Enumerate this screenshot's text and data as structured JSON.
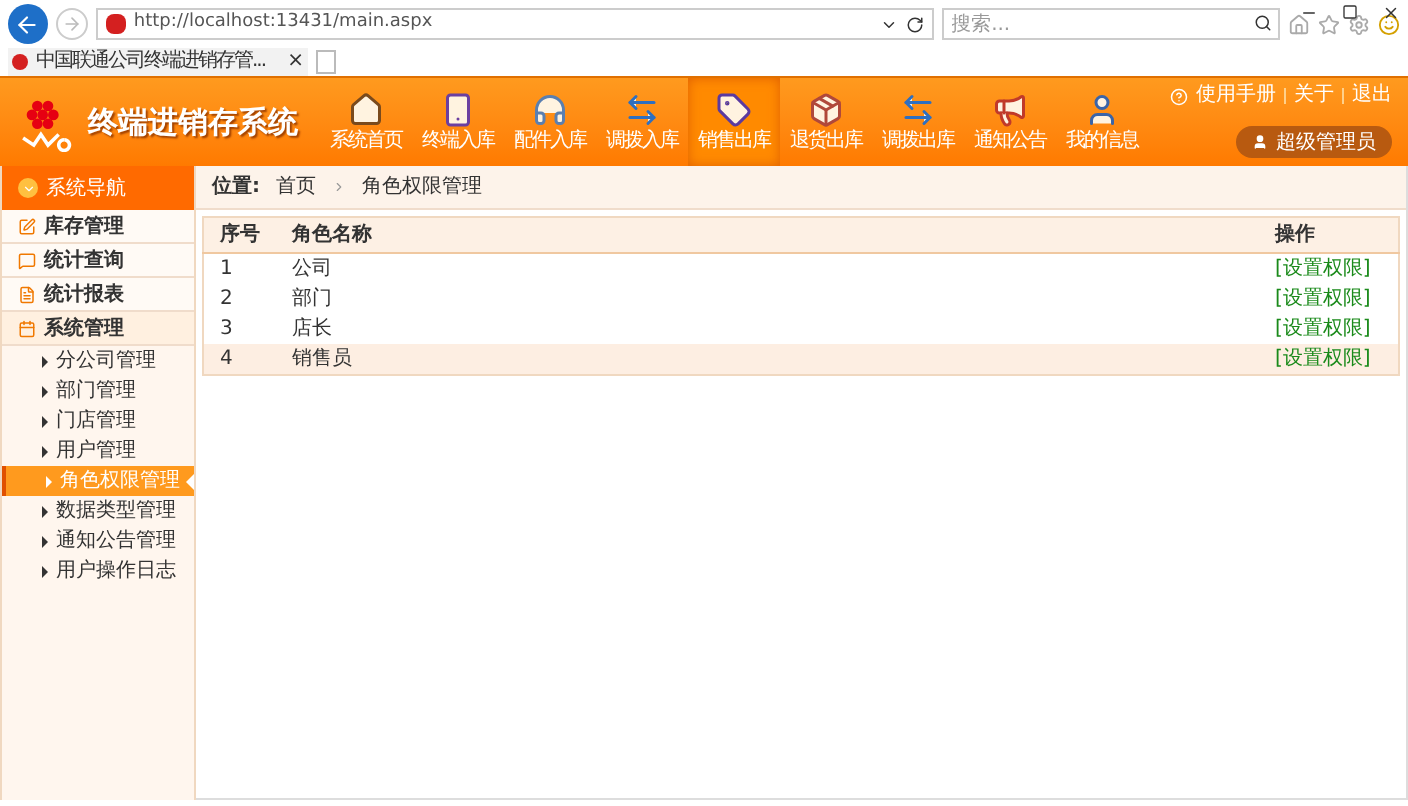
{
  "browser": {
    "url": "http://localhost:13431/main.aspx",
    "search": {
      "placeholder": "搜索..."
    },
    "tab": {
      "title": "中国联通公司终端进销存管...",
      "close": "×"
    }
  },
  "header": {
    "title": "终端进销存系统",
    "links": [
      "使用手册",
      "关于",
      "退出"
    ],
    "user": "超级管理员",
    "nav": [
      {
        "label": "系统首页",
        "selected": false
      },
      {
        "label": "终端入库",
        "selected": false
      },
      {
        "label": "配件入库",
        "selected": false
      },
      {
        "label": "调拨入库",
        "selected": false
      },
      {
        "label": "销售出库",
        "selected": true
      },
      {
        "label": "退货出库",
        "selected": false
      },
      {
        "label": "调拨出库",
        "selected": false
      },
      {
        "label": "通知公告",
        "selected": false
      },
      {
        "label": "我的信息",
        "selected": false
      }
    ]
  },
  "sidebar": {
    "title": "系统导航",
    "groups": [
      {
        "label": "库存管理",
        "expanded": false
      },
      {
        "label": "统计查询",
        "expanded": false
      },
      {
        "label": "统计报表",
        "expanded": false
      },
      {
        "label": "系统管理",
        "expanded": true,
        "children": [
          {
            "label": "分公司管理",
            "selected": false
          },
          {
            "label": "部门管理",
            "selected": false
          },
          {
            "label": "门店管理",
            "selected": false
          },
          {
            "label": "用户管理",
            "selected": false
          },
          {
            "label": "角色权限管理",
            "selected": true
          },
          {
            "label": "数据类型管理",
            "selected": false
          },
          {
            "label": "通知公告管理",
            "selected": false
          },
          {
            "label": "用户操作日志",
            "selected": false
          }
        ]
      }
    ]
  },
  "breadcrumb": {
    "label": "位置:",
    "items": [
      "首页",
      "角色权限管理"
    ]
  },
  "table": {
    "columns": [
      "序号",
      "角色名称",
      "操作"
    ],
    "rows": [
      {
        "cells": [
          "1",
          "公司"
        ],
        "action": "[设置权限]",
        "highlighted": false
      },
      {
        "cells": [
          "2",
          "部门"
        ],
        "action": "[设置权限]",
        "highlighted": false
      },
      {
        "cells": [
          "3",
          "店长"
        ],
        "action": "[设置权限]",
        "highlighted": false
      },
      {
        "cells": [
          "4",
          "销售员"
        ],
        "action": "[设置权限]",
        "highlighted": true
      }
    ]
  }
}
